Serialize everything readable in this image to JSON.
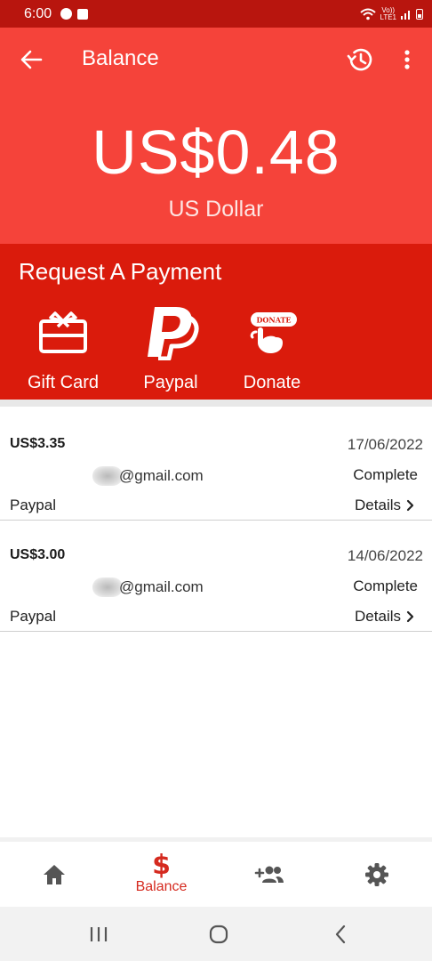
{
  "status_bar": {
    "time": "6:00",
    "lte_top": "Vo))",
    "lte_bottom": "LTE1"
  },
  "toolbar": {
    "title": "Balance",
    "back_icon": "arrow-left-icon",
    "history_icon": "history-icon",
    "more_icon": "more-vert-icon"
  },
  "balance": {
    "amount": "US$0.48",
    "currency": "US Dollar"
  },
  "request": {
    "title": "Request A Payment",
    "options": [
      {
        "label": "Gift Card",
        "icon": "gift-card-icon"
      },
      {
        "label": "Paypal",
        "icon": "paypal-icon"
      },
      {
        "label": "Donate",
        "icon": "donate-icon",
        "badge_text": "DONATE"
      }
    ]
  },
  "transactions": [
    {
      "amount": "US$3.35",
      "date": "17/06/2022",
      "email": "@gmail.com",
      "status": "Complete",
      "method": "Paypal",
      "details": "Details"
    },
    {
      "amount": "US$3.00",
      "date": "14/06/2022",
      "email": "@gmail.com",
      "status": "Complete",
      "method": "Paypal",
      "details": "Details"
    }
  ],
  "bottom_nav": {
    "items": [
      {
        "icon": "home-icon",
        "label": ""
      },
      {
        "icon": "dollar-icon",
        "label": "Balance",
        "glyph": "$",
        "active": true
      },
      {
        "icon": "add-friends-icon",
        "label": ""
      },
      {
        "icon": "settings-icon",
        "label": ""
      }
    ]
  },
  "colors": {
    "header": "#f5433a",
    "request_bg": "#da1b0c",
    "status_bar": "#b8150e",
    "accent": "#d52a1f"
  }
}
